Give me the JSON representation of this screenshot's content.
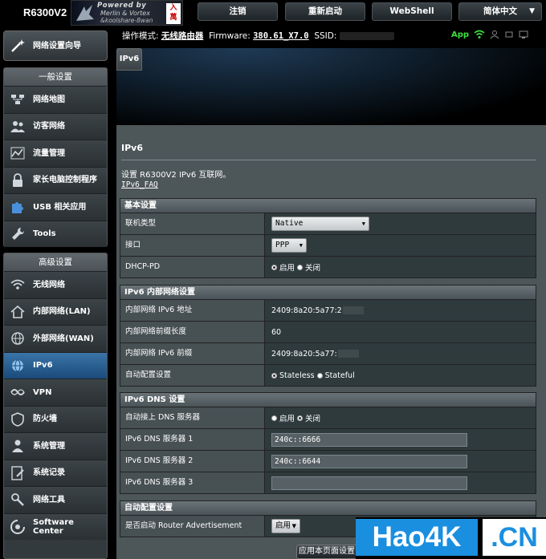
{
  "header": {
    "model": "R6300V2",
    "logo_line1": "Powered by",
    "logo_line2": "Merlin & Vortex",
    "logo_line3": "&koolshare-8wan",
    "logo_badge": "入\n萬",
    "logout": "注销",
    "reboot": "重新启动",
    "webshell": "WebShell",
    "language": "简体中文"
  },
  "info": {
    "mode_label": "操作模式:",
    "mode_value": "无线路由器",
    "fw_label": "Firmware:",
    "fw_value": "380.61_X7.0",
    "ssid_label": "SSID:",
    "app_label": "App"
  },
  "sidebar": {
    "wizard": "网络设置向导",
    "general_head": "一般设置",
    "general": [
      {
        "label": "网络地图",
        "icon": "network-map-icon"
      },
      {
        "label": "访客网络",
        "icon": "guest-network-icon"
      },
      {
        "label": "流量管理",
        "icon": "traffic-icon"
      },
      {
        "label": "家长电脑控制程序",
        "icon": "parental-lock-icon"
      },
      {
        "label": "USB 相关应用",
        "icon": "puzzle-icon"
      },
      {
        "label": "Tools",
        "icon": "wrench-icon"
      }
    ],
    "advanced_head": "高级设置",
    "advanced": [
      {
        "label": "无线网络",
        "icon": "wifi-icon"
      },
      {
        "label": "内部网络(LAN)",
        "icon": "home-icon"
      },
      {
        "label": "外部网络(WAN)",
        "icon": "globe-icon"
      },
      {
        "label": "IPv6",
        "icon": "ipv6-globe-icon"
      },
      {
        "label": "VPN",
        "icon": "vpn-icon"
      },
      {
        "label": "防火墙",
        "icon": "shield-icon"
      },
      {
        "label": "系统管理",
        "icon": "user-admin-icon"
      },
      {
        "label": "系统记录",
        "icon": "log-icon"
      },
      {
        "label": "网络工具",
        "icon": "network-tools-icon"
      },
      {
        "label": "Software\nCenter",
        "icon": "software-center-icon"
      }
    ]
  },
  "tab": "IPv6",
  "page": {
    "title": "IPv6",
    "desc": "设置 R6300V2 IPv6 互联网。",
    "faq": "IPv6_FAQ",
    "apply": "应用本页面设置"
  },
  "basic": {
    "head": "基本设置",
    "conn_type_label": "联机类型",
    "conn_type_value": "Native",
    "interface_label": "接口",
    "interface_value": "PPP",
    "dhcp_pd_label": "DHCP-PD",
    "enable": "启用",
    "disable": "关闭"
  },
  "lan": {
    "head": "IPv6 内部网络设置",
    "addr_label": "内部网络 IPv6 地址",
    "addr_value": "2409:8a20:5a77:2",
    "prefix_len_label": "内部网络前缀长度",
    "prefix_len_value": "60",
    "prefix_label": "内部网络 IPv6 前缀",
    "prefix_value": "2409:8a20:5a77:",
    "autoconf_label": "自动配置设置",
    "stateless": "Stateless",
    "stateful": "Stateful"
  },
  "dns": {
    "head": "IPv6 DNS 设置",
    "auto_label": "自动接上 DNS 服务器",
    "enable": "启用",
    "disable": "关闭",
    "dns1_label": "IPv6 DNS 服务器 1",
    "dns1_value": "240c::6666",
    "dns2_label": "IPv6 DNS 服务器 2",
    "dns2_value": "240c::6644",
    "dns3_label": "IPv6 DNS 服务器 3",
    "dns3_value": ""
  },
  "autoconf": {
    "head": "自动配置设置",
    "ra_label": "是否启动 Router Advertisement",
    "ra_value": "启用"
  },
  "watermark": {
    "left": "Hao4K",
    "right": ".CN"
  },
  "colors": {
    "accent": "#1b4a7a",
    "panel": "#4d5659",
    "watermark": "#1a8fe0"
  }
}
